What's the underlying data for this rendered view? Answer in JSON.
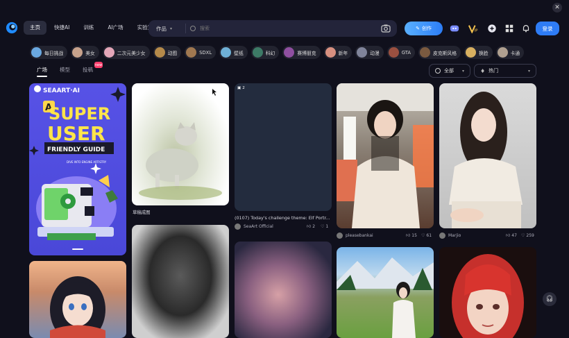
{
  "header": {
    "nav": [
      "主页",
      "快捷AI",
      "训练",
      "AI广场",
      "实验室"
    ],
    "search_type": "作品",
    "search_placeholder": "搜索",
    "create_label": "创作",
    "login_label": "登录"
  },
  "tags": [
    {
      "label": "每日挑战",
      "color": "#6aa8e0"
    },
    {
      "label": "美女",
      "color": "#c7a28c"
    },
    {
      "label": "二次元美少女",
      "color": "#e3a6b8"
    },
    {
      "label": "动图",
      "color": "#b58a4a"
    },
    {
      "label": "SDXL",
      "color": "#a07850"
    },
    {
      "label": "壁纸",
      "color": "#6fb0d6"
    },
    {
      "label": "科幻",
      "color": "#3d7a66"
    },
    {
      "label": "赛博朋克",
      "color": "#8f4fa0"
    },
    {
      "label": "新年",
      "color": "#d89080"
    },
    {
      "label": "动漫",
      "color": "#80849a"
    },
    {
      "label": "GTA",
      "color": "#9a5040"
    },
    {
      "label": "皮克斯风格",
      "color": "#7a5a40"
    },
    {
      "label": "换脸",
      "color": "#d8b060"
    },
    {
      "label": "卡通",
      "color": "#b0a090"
    }
  ],
  "subtabs": [
    "广场",
    "模型",
    "投稿"
  ],
  "subtab_badge": "new",
  "filters": {
    "time": "全部",
    "sort": "热门"
  },
  "cards": {
    "guide": {
      "brand": "SEAART·AI",
      "letter": "A",
      "line1": "SUPER",
      "line2": "USER",
      "line3": "FRIENDLY GUIDE",
      "tagline": "DIVE INTO ENGINE ARTISTRY"
    },
    "sketch": {
      "caption": "草稿成图"
    },
    "challenge": {
      "count": "2",
      "title": "(0107) Today's challenge theme: Elf Portr...",
      "author": "SeaArt Official",
      "likes": "2",
      "hearts": "1"
    },
    "girl_train": {
      "author": "pleasebankai",
      "likes": "15",
      "hearts": "61"
    },
    "girl_sweater": {
      "author": "Marjio",
      "likes": "47",
      "hearts": "259"
    }
  }
}
